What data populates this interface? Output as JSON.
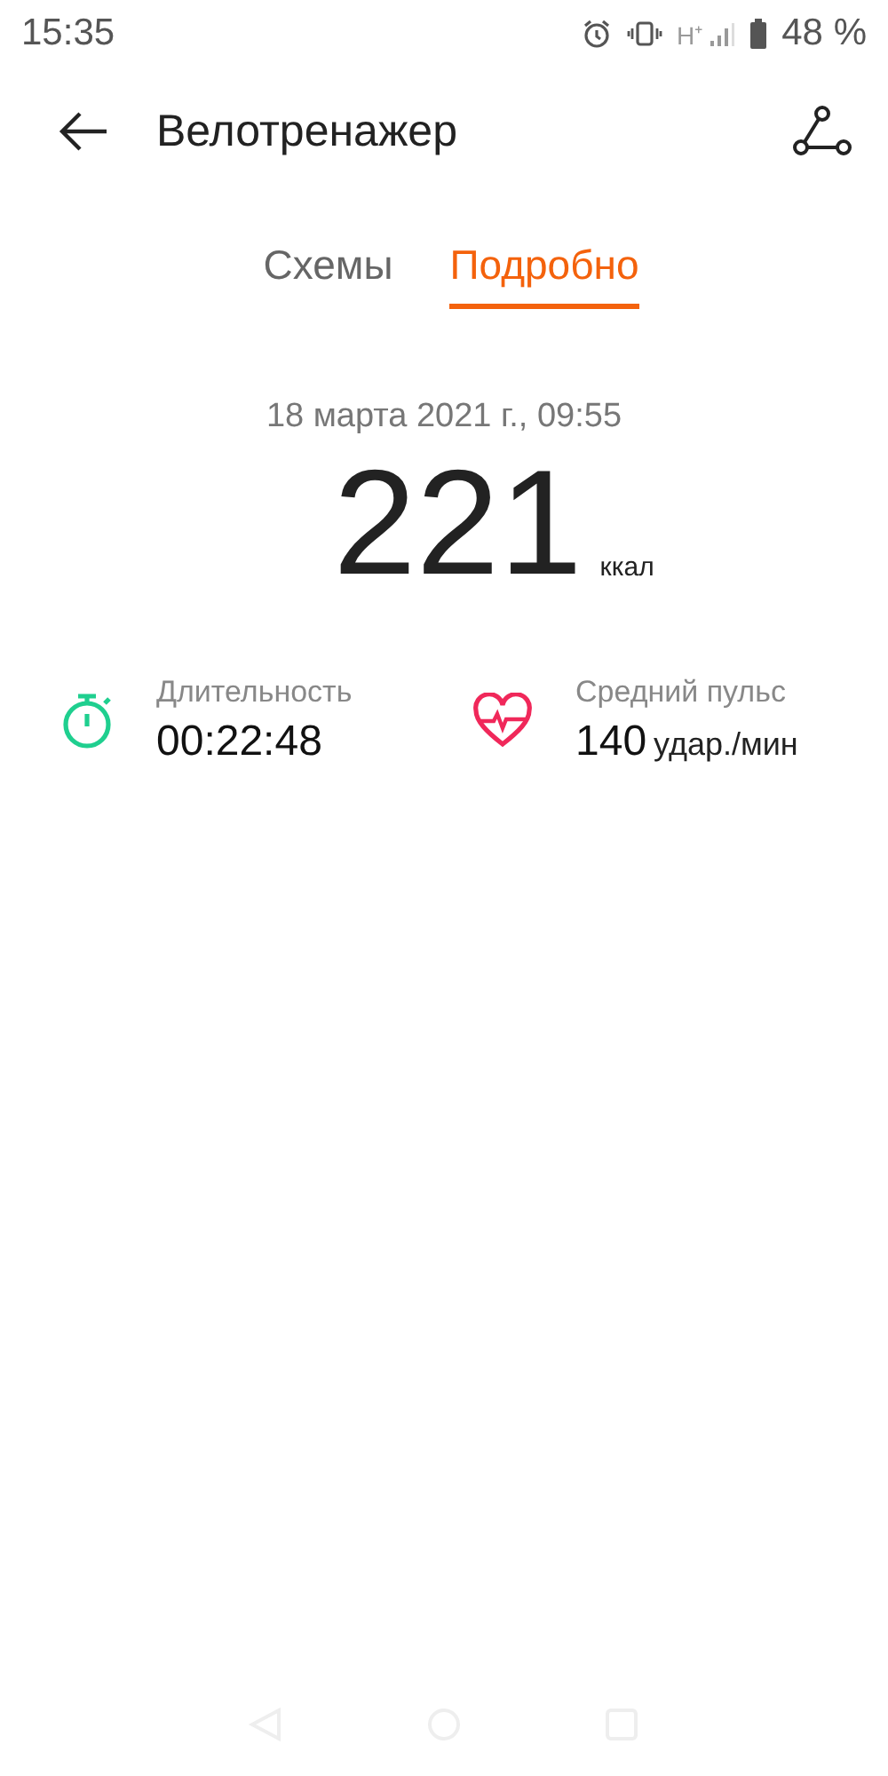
{
  "status_bar": {
    "time": "15:35",
    "network": "H⁺",
    "battery": "48 %"
  },
  "header": {
    "title": "Велотренажер"
  },
  "tabs": [
    {
      "label": "Схемы",
      "selected": false
    },
    {
      "label": "Подробно",
      "selected": true
    }
  ],
  "summary": {
    "date": "18 марта 2021 г., 09:55",
    "calories": "221",
    "calories_unit": "ккал"
  },
  "stats": [
    {
      "kind": "duration",
      "label": "Длительность",
      "value": "00:22:48"
    },
    {
      "kind": "heart",
      "label": "Средний пульс",
      "value": "140",
      "unit": "удар./мин"
    }
  ]
}
